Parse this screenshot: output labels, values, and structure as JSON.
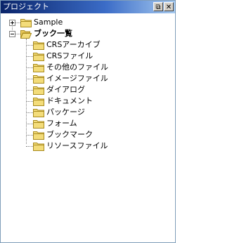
{
  "window": {
    "title": "プロジェクト",
    "pin_icon": "pin-icon",
    "close_icon": "close-icon",
    "pin_glyph": "⧉",
    "close_glyph": "✕"
  },
  "tree": {
    "nodes": [
      {
        "label": "Sample",
        "expanded": false,
        "icon": "folder-icon"
      },
      {
        "label": "ブック一覧",
        "expanded": true,
        "icon": "folder-icon",
        "bold": true,
        "children": [
          {
            "label": "CRSアーカイブ",
            "icon": "folder-icon"
          },
          {
            "label": "CRSファイル",
            "icon": "folder-icon"
          },
          {
            "label": "その他のファイル",
            "icon": "folder-icon"
          },
          {
            "label": "イメージファイル",
            "icon": "folder-icon"
          },
          {
            "label": "ダイアログ",
            "icon": "folder-icon"
          },
          {
            "label": "ドキュメント",
            "icon": "folder-icon"
          },
          {
            "label": "パッケージ",
            "icon": "folder-icon"
          },
          {
            "label": "フォーム",
            "icon": "folder-icon"
          },
          {
            "label": "ブックマーク",
            "icon": "folder-icon"
          },
          {
            "label": "リソースファイル",
            "icon": "folder-icon"
          }
        ]
      }
    ]
  },
  "colors": {
    "titlebar_start": "#0a246a",
    "titlebar_end": "#a6caf0",
    "folder_fill": "#f3dc7a",
    "folder_stroke": "#a88a1d"
  }
}
